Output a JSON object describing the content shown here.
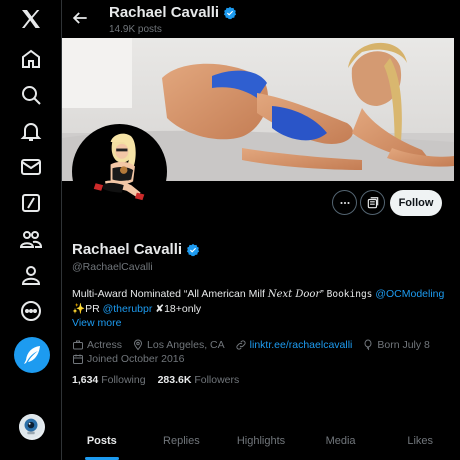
{
  "colors": {
    "accent": "#1d9bf0",
    "background": "#000000",
    "text": "#e7e9ea",
    "muted": "#71767b"
  },
  "nav": {
    "items": [
      {
        "name": "x-logo-icon"
      },
      {
        "name": "home-icon"
      },
      {
        "name": "explore-icon"
      },
      {
        "name": "notifications-icon"
      },
      {
        "name": "messages-icon"
      },
      {
        "name": "grok-icon"
      },
      {
        "name": "communities-icon"
      },
      {
        "name": "profile-icon"
      },
      {
        "name": "more-icon"
      }
    ],
    "post_button_icon": "feather-icon"
  },
  "header": {
    "name": "Rachael Cavalli",
    "post_count": "14.9K posts"
  },
  "actions": {
    "more_icon": "ellipsis-icon",
    "subscribe_icon": "newsletter-icon",
    "follow_label": "Follow"
  },
  "profile": {
    "name": "Rachael Cavalli",
    "handle": "@RachaelCavalli",
    "bio": {
      "part1": "Multi-Award Nominated “All American Milf ",
      "part2": "Next Door",
      "part3": "” ",
      "part4": "Bookings",
      "part5": " ",
      "mention1": "@OCModeling",
      "line2_a": "✨PR ",
      "mention2": "@therubpr",
      "line2_b": " ✘18+only"
    },
    "view_more": "View more",
    "category": "Actress",
    "location": "Los Angeles, CA",
    "website": "linktr.ee/rachaelcavalli",
    "birthday": "Born July 8",
    "joined": "Joined October 2016",
    "following_count": "1,634",
    "following_label": "Following",
    "followers_count": "283.6K",
    "followers_label": "Followers"
  },
  "tabs": [
    {
      "label": "Posts",
      "active": true
    },
    {
      "label": "Replies",
      "active": false
    },
    {
      "label": "Highlights",
      "active": false
    },
    {
      "label": "Media",
      "active": false
    },
    {
      "label": "Likes",
      "active": false
    }
  ]
}
